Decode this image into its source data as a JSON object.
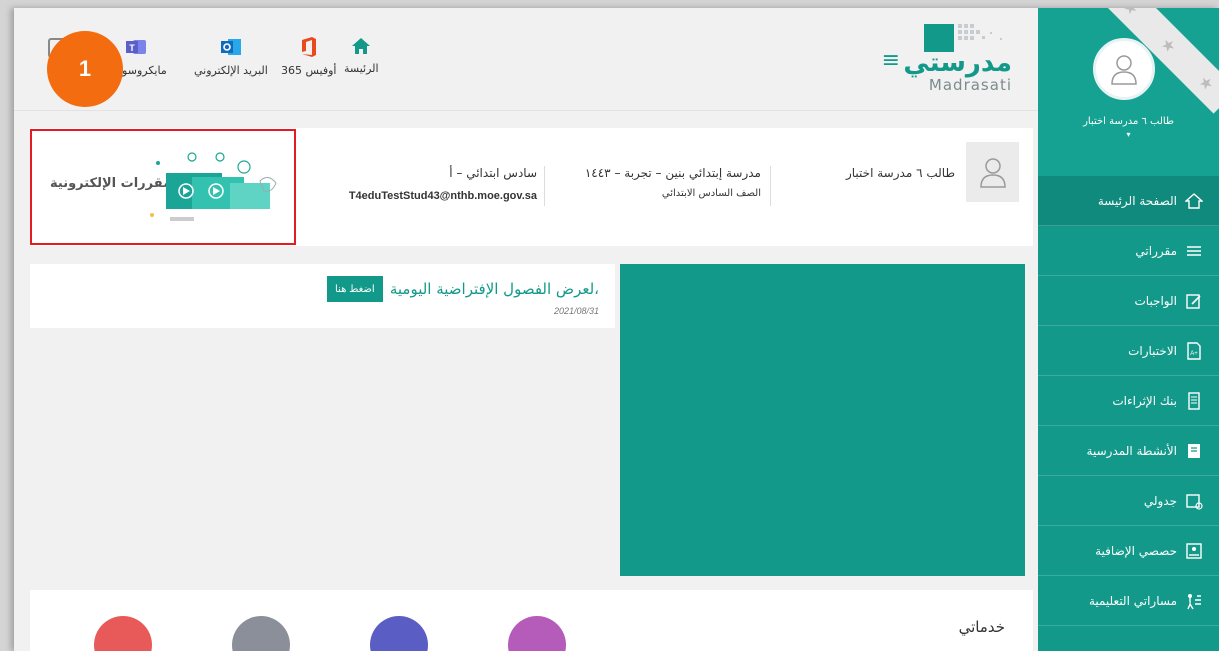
{
  "sidebar": {
    "user_name": "طالب ٦ مدرسة اختبار",
    "items": [
      {
        "label": "الصفحة الرئيسة",
        "icon": "home-icon"
      },
      {
        "label": "مقرراتي",
        "icon": "books-icon"
      },
      {
        "label": "الواجبات",
        "icon": "edit-icon"
      },
      {
        "label": "الاختبارات",
        "icon": "exam-icon"
      },
      {
        "label": "بنك الإثراءات",
        "icon": "document-icon"
      },
      {
        "label": "الأنشطة المدرسية",
        "icon": "activity-icon"
      },
      {
        "label": "جدولي",
        "icon": "calendar-icon"
      },
      {
        "label": "حصصي الإضافية",
        "icon": "classes-icon"
      },
      {
        "label": "مساراتي التعليمية",
        "icon": "path-icon"
      }
    ]
  },
  "header": {
    "logo_ar": "مدرستي",
    "logo_en": "Madrasati",
    "links": [
      {
        "label": "الرئيسة",
        "icon": "home-icon",
        "color": "#12998a"
      },
      {
        "label": "أوفيس 365",
        "icon": "office-icon",
        "color": "#e8491d"
      },
      {
        "label": "البريد الإلكتروني",
        "icon": "outlook-icon",
        "color": "#0f6cbd"
      },
      {
        "label": "مايكروسوفت",
        "icon": "teams-icon",
        "color": "#5b5fc7"
      }
    ],
    "badge": "1"
  },
  "profile": {
    "name": "طالب ٦ مدرسة اختبار",
    "school": "مدرسة إبتدائي بنين – تجربة – ١٤٤٣",
    "grade": "الصف السادس الابتدائي",
    "class": "سادس ابتدائي – أ",
    "email": "T4eduTestStud43@nthb.moe.gov.sa",
    "ecourses": "المقررات الإلكترونية"
  },
  "virtual": {
    "text": "لعرض الفصول الإفتراضية اليومية،",
    "button": "اضغط هنا",
    "date": "2021/08/31"
  },
  "services": {
    "title": "خدماتي",
    "colors": [
      "#b55bb9",
      "#5a5ec4",
      "#8a8f99",
      "#e85a5a"
    ]
  }
}
